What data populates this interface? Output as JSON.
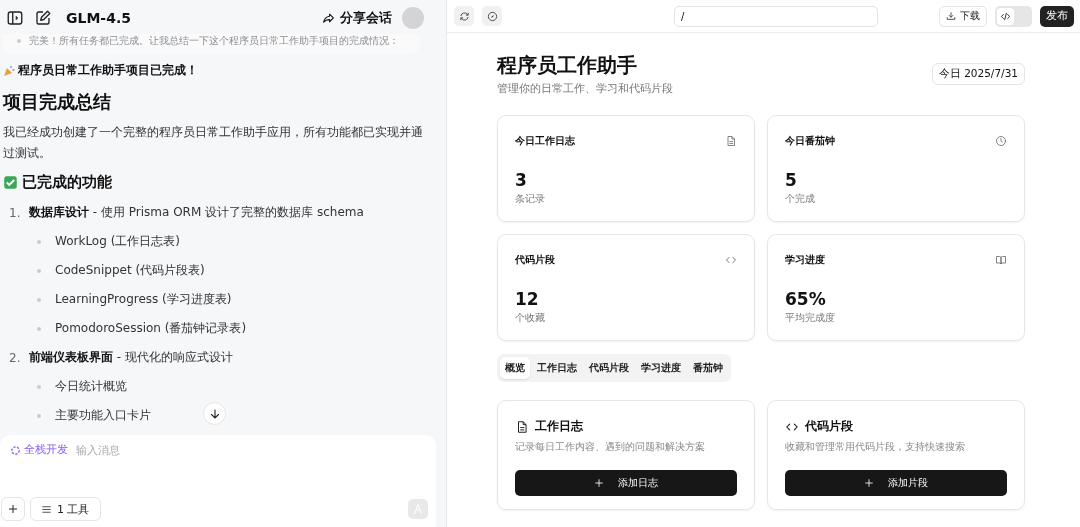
{
  "chat": {
    "model": "GLM-4.5",
    "share": "分享会话",
    "faded_note": "完美！所有任务都已完成。让我总结一下这个程序员日常工作助手项目的完成情况：",
    "announcement": "程序员日常工作助手项目已完成！",
    "heading": "项目完成总结",
    "paragraph": "我已经成功创建了一个完整的程序员日常工作助手应用，所有功能都已实现并通过测试。",
    "section": "已完成的功能",
    "list": [
      {
        "number": "1.",
        "title": "数据库设计",
        "desc": " - 使用 Prisma ORM 设计了完整的数据库 schema",
        "children": [
          "WorkLog (工作日志表)",
          "CodeSnippet (代码片段表)",
          "LearningProgress (学习进度表)",
          "PomodoroSession (番茄钟记录表)"
        ]
      },
      {
        "number": "2.",
        "title": "前端仪表板界面",
        "desc": " - 现代化的响应式设计",
        "children": [
          "今日统计概览",
          "主要功能入口卡片"
        ]
      }
    ],
    "composer": {
      "mode": "全栈开发",
      "placeholder": "输入消息",
      "tools": "1 工具"
    }
  },
  "preview": {
    "url": "/",
    "download": "下载",
    "code_view_on": false,
    "publish": "发布",
    "title": "程序员工作助手",
    "subtitle": "管理你的日常工作、学习和代码片段",
    "date": "今日 2025/7/31",
    "stats": [
      {
        "label": "今日工作日志",
        "kind": "doc",
        "value": "3",
        "unit": "条记录"
      },
      {
        "label": "今日番茄钟",
        "kind": "clock",
        "value": "5",
        "unit": "个完成"
      },
      {
        "label": "代码片段",
        "kind": "code",
        "value": "12",
        "unit": "个收藏"
      },
      {
        "label": "学习进度",
        "kind": "book",
        "value": "65%",
        "unit": "平均完成度"
      }
    ],
    "tabs": [
      {
        "label": "概览",
        "selected": true
      },
      {
        "label": "工作日志",
        "selected": false
      },
      {
        "label": "代码片段",
        "selected": false
      },
      {
        "label": "学习进度",
        "selected": false
      },
      {
        "label": "番茄钟",
        "selected": false
      }
    ],
    "features": [
      {
        "kind": "doc",
        "title": "工作日志",
        "desc": "记录每日工作内容、遇到的问题和解决方案",
        "button": "添加日志"
      },
      {
        "kind": "code",
        "title": "代码片段",
        "desc": "收藏和管理常用代码片段，支持快速搜索",
        "button": "添加片段"
      }
    ]
  }
}
